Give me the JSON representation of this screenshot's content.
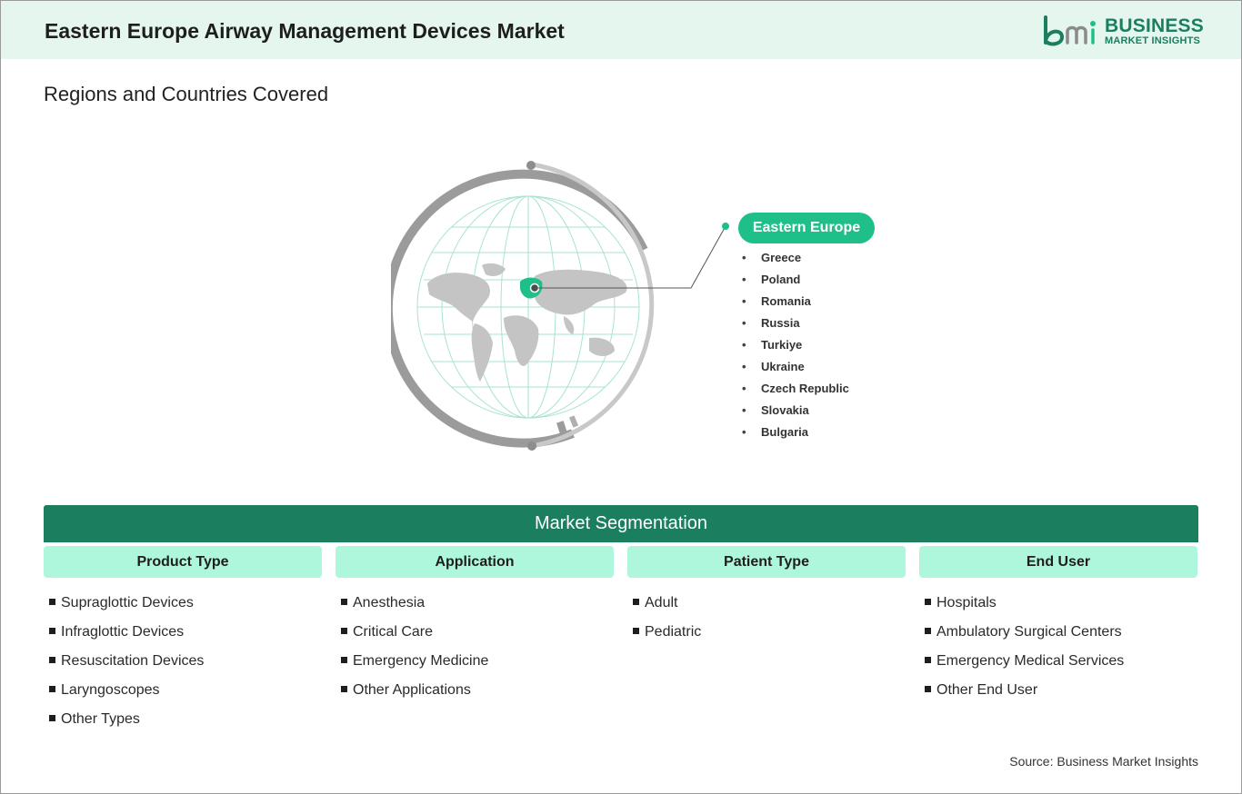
{
  "header": {
    "title": "Eastern Europe Airway Management Devices Market",
    "logo_primary": "BUSINESS",
    "logo_secondary": "MARKET INSIGHTS"
  },
  "regions": {
    "title": "Regions and Countries Covered",
    "region_name": "Eastern Europe",
    "countries": [
      "Greece",
      "Poland",
      "Romania",
      "Russia",
      "Turkiye",
      "Ukraine",
      "Czech Republic",
      "Slovakia",
      "Bulgaria"
    ],
    "globe_icon": "world-globe-icon"
  },
  "segmentation": {
    "title": "Market Segmentation",
    "columns": [
      {
        "heading": "Product Type",
        "items": [
          "Supraglottic Devices",
          "Infraglottic Devices",
          "Resuscitation Devices",
          "Laryngoscopes",
          "Other Types"
        ]
      },
      {
        "heading": "Application",
        "items": [
          "Anesthesia",
          "Critical Care",
          "Emergency Medicine",
          "Other Applications"
        ]
      },
      {
        "heading": "Patient Type",
        "items": [
          "Adult",
          "Pediatric"
        ]
      },
      {
        "heading": "End User",
        "items": [
          "Hospitals",
          "Ambulatory Surgical Centers",
          "Emergency Medical Services",
          "Other End User"
        ]
      }
    ]
  },
  "footer": {
    "source": "Source: Business Market Insights"
  },
  "colors": {
    "brand_green": "#1b7f5f",
    "accent_green": "#1fbf8a",
    "header_bg": "#e4f6ee",
    "segment_head_bg": "#aef7dc"
  }
}
